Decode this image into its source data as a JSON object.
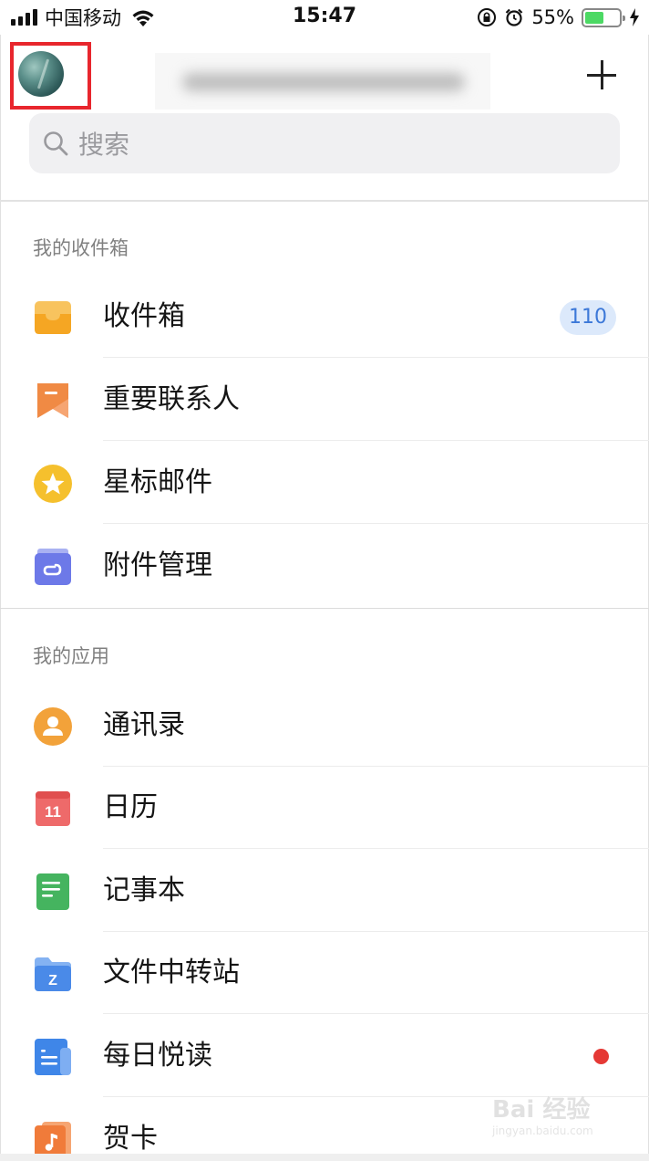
{
  "status_bar": {
    "carrier": "中国移动",
    "time": "15:47",
    "battery_percent": "55%",
    "battery_level": 0.55,
    "icons": [
      "signal-icon",
      "wifi-icon",
      "orientation-lock-icon",
      "alarm-icon",
      "battery-icon",
      "charging-icon"
    ]
  },
  "header": {
    "add_icon": "plus-icon"
  },
  "search": {
    "placeholder": "搜索",
    "icon": "search-icon"
  },
  "sections": [
    {
      "title": "我的收件箱",
      "items": [
        {
          "label": "收件箱",
          "icon": "inbox-icon",
          "color": "#f5a623",
          "badge": "110"
        },
        {
          "label": "重要联系人",
          "icon": "bookmark-icon",
          "color": "#f08a44"
        },
        {
          "label": "星标邮件",
          "icon": "star-icon",
          "color": "#f5c02d"
        },
        {
          "label": "附件管理",
          "icon": "attachment-icon",
          "color": "#6d79e8"
        }
      ]
    },
    {
      "title": "我的应用",
      "items": [
        {
          "label": "通讯录",
          "icon": "contacts-icon",
          "color": "#f2a23a"
        },
        {
          "label": "日历",
          "icon": "calendar-icon",
          "color": "#ee6a6a",
          "icon_text": "11"
        },
        {
          "label": "记事本",
          "icon": "notepad-icon",
          "color": "#45b45f"
        },
        {
          "label": "文件中转站",
          "icon": "folder-icon",
          "color": "#4a8ae8",
          "icon_text": "Z"
        },
        {
          "label": "每日悦读",
          "icon": "reading-icon",
          "color": "#3f86e8",
          "dot": true
        },
        {
          "label": "贺卡",
          "icon": "greeting-card-icon",
          "color": "#f07b3a"
        }
      ]
    }
  ],
  "colors": {
    "highlight_frame": "#e8262d",
    "badge_bg": "#dce9fb",
    "badge_text": "#3c78d8",
    "red_dot": "#e53935"
  },
  "watermark": {
    "text": "Bai 经验",
    "subtext": "jingyan.baidu.com"
  }
}
